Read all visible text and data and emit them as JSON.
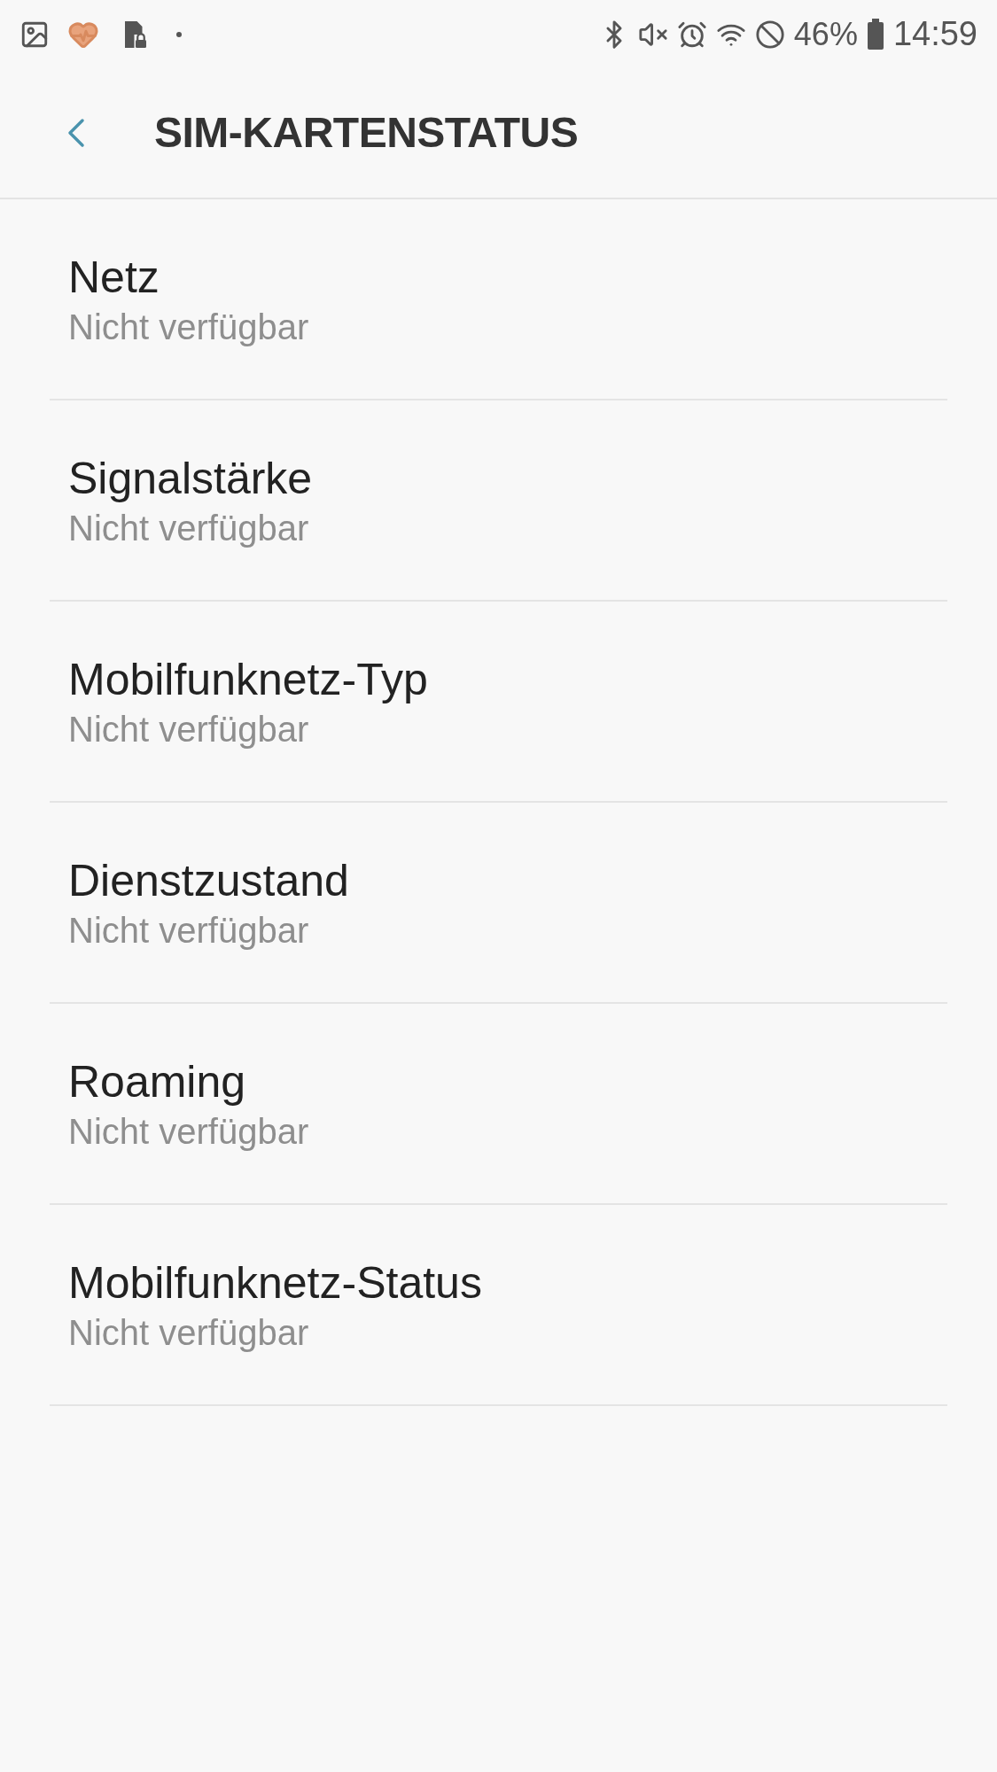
{
  "status_bar": {
    "battery": "46%",
    "time": "14:59"
  },
  "header": {
    "title": "SIM-KARTENSTATUS"
  },
  "items": [
    {
      "title": "Netz",
      "value": "Nicht verfügbar"
    },
    {
      "title": "Signalstärke",
      "value": "Nicht verfügbar"
    },
    {
      "title": "Mobilfunknetz-Typ",
      "value": "Nicht verfügbar"
    },
    {
      "title": "Dienstzustand",
      "value": "Nicht verfügbar"
    },
    {
      "title": "Roaming",
      "value": "Nicht verfügbar"
    },
    {
      "title": "Mobilfunknetz-Status",
      "value": "Nicht verfügbar"
    }
  ]
}
